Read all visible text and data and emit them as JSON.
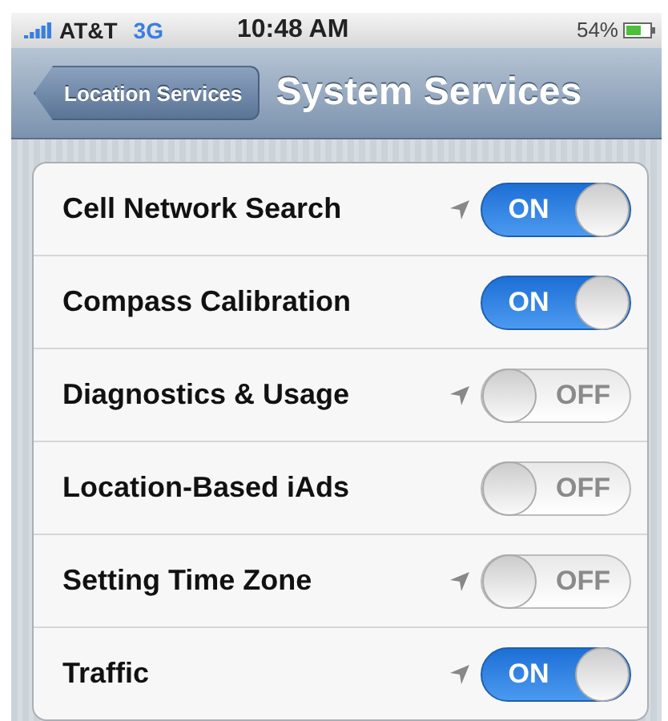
{
  "status_bar": {
    "carrier": "AT&T",
    "network": "3G",
    "time": "10:48 AM",
    "battery": "54%"
  },
  "nav_bar": {
    "back": "Location Services",
    "title": "System Services"
  },
  "rows": [
    {
      "label": "Cell Network Search",
      "location_arrow": true,
      "on": true,
      "switch_text": "ON"
    },
    {
      "label": "Compass Calibration",
      "location_arrow": false,
      "on": true,
      "switch_text": "ON"
    },
    {
      "label": "Diagnostics & Usage",
      "location_arrow": true,
      "on": false,
      "switch_text": "OFF"
    },
    {
      "label": "Location-Based iAds",
      "location_arrow": false,
      "on": false,
      "switch_text": "OFF"
    },
    {
      "label": "Setting Time Zone",
      "location_arrow": true,
      "on": false,
      "switch_text": "OFF"
    },
    {
      "label": "Traffic",
      "location_arrow": true,
      "on": true,
      "switch_text": "ON"
    }
  ]
}
